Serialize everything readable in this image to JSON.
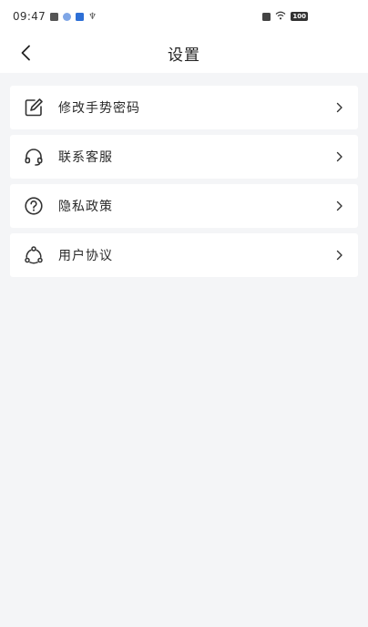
{
  "status_bar": {
    "time": "09:47",
    "battery": "100"
  },
  "header": {
    "title": "设置"
  },
  "menu": [
    {
      "label": "修改手势密码",
      "icon": "edit-icon"
    },
    {
      "label": "联系客服",
      "icon": "headset-icon"
    },
    {
      "label": "隐私政策",
      "icon": "question-icon"
    },
    {
      "label": "用户协议",
      "icon": "share-icon"
    }
  ],
  "colors": {
    "background": "#f4f5f7",
    "card": "#ffffff",
    "text": "#222222",
    "icon": "#333333"
  }
}
